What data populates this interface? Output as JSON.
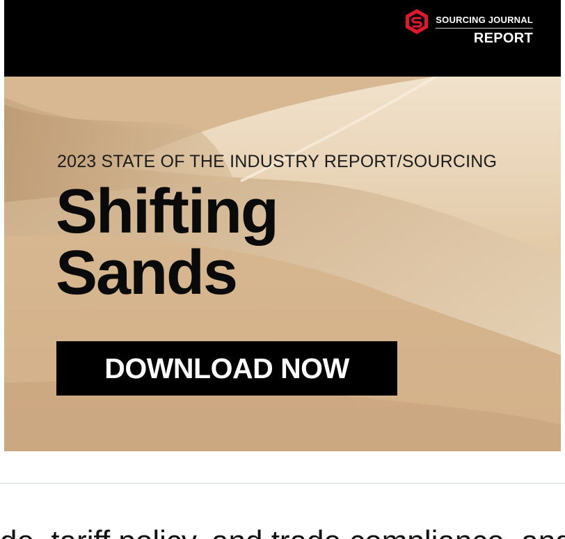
{
  "ad": {
    "brand_name": "SOURCING JOURNAL",
    "brand_report": "REPORT",
    "eyebrow": "2023 STATE OF THE INDUSTRY REPORT/SOURCING",
    "headline_line1": "Shifting",
    "headline_line2": "Sands",
    "cta_label": "DOWNLOAD NOW",
    "brand_logo_icon": "hexagon-s-logo-icon",
    "colors": {
      "header_bg": "#000000",
      "logo_red": "#e0182d",
      "sand": "#dcc09d",
      "cta_bg": "#000000"
    }
  },
  "article": {
    "partial_text": "de, tariff policy, and trade compliance, and a broader shift in sourcing applications across the global supply chain"
  }
}
